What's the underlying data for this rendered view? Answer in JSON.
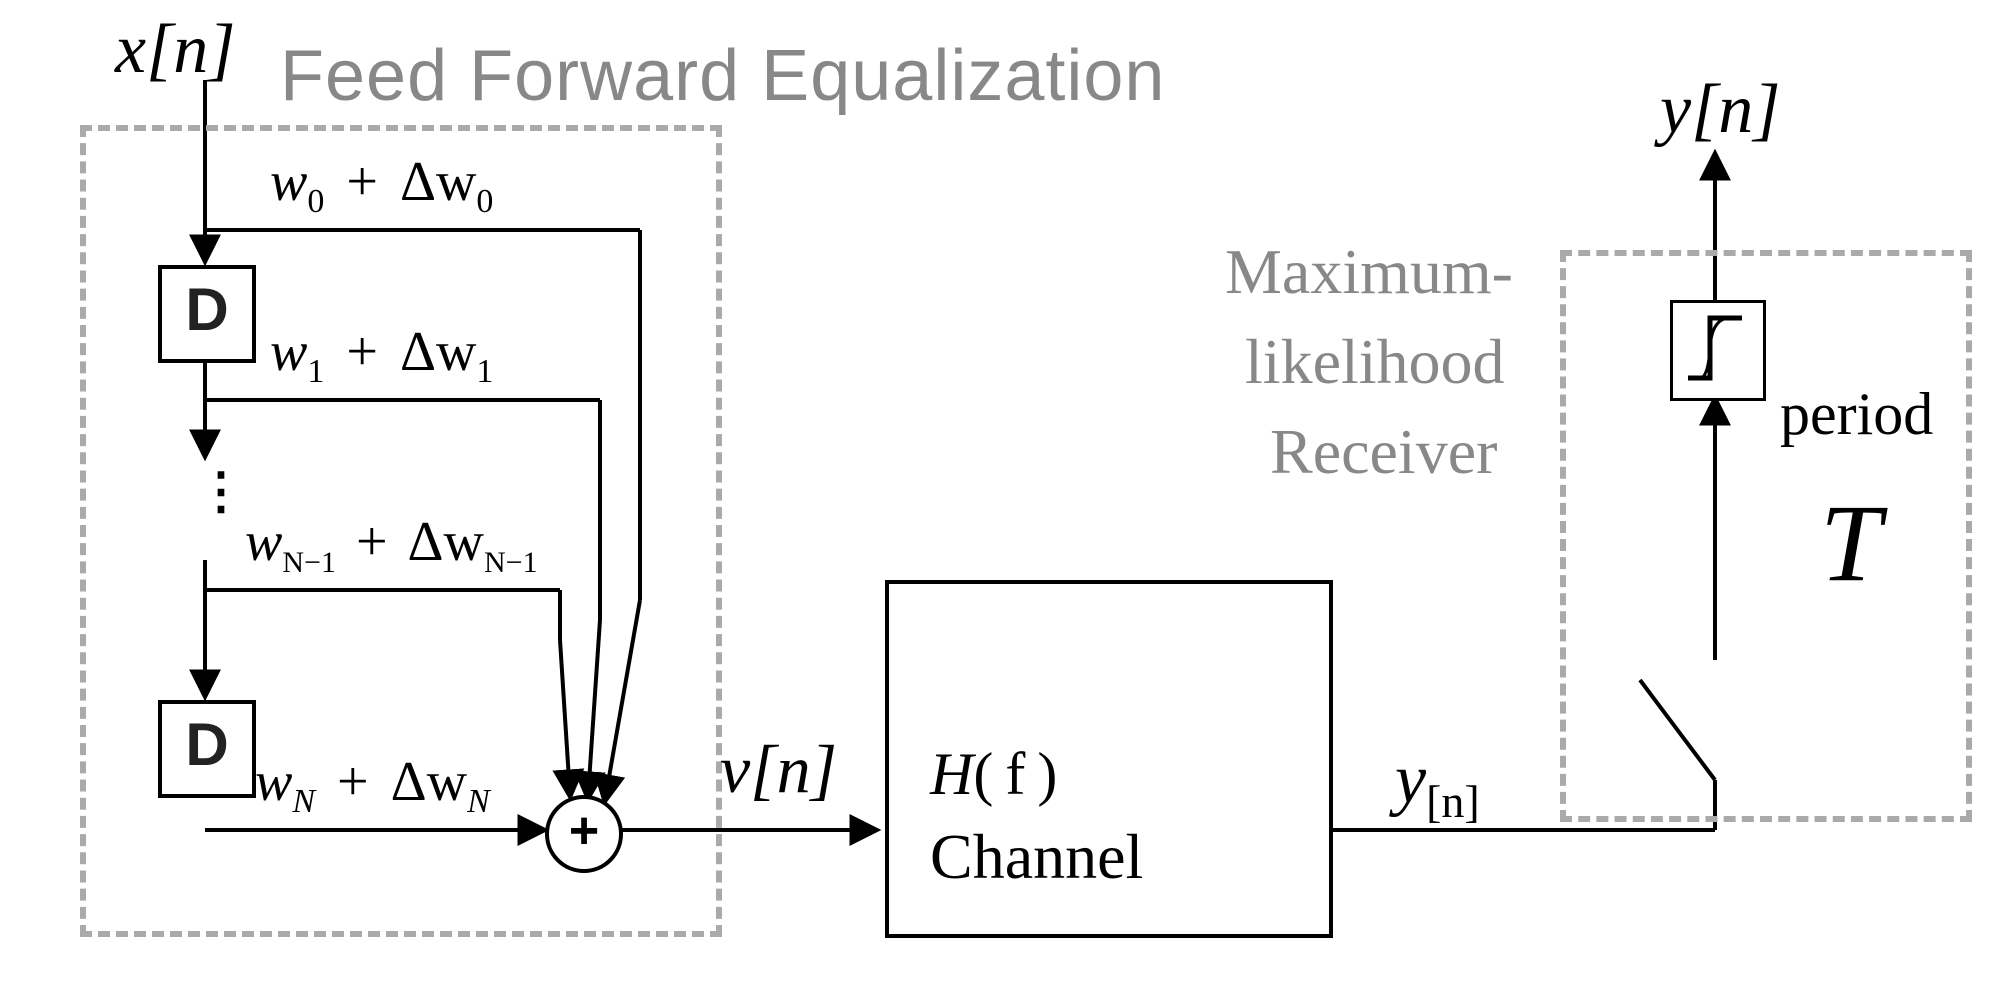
{
  "title": "Feed Forward Equalization",
  "receiver": {
    "line1": "Maximum-",
    "line2": "likelihood",
    "line3": "Receiver"
  },
  "signals": {
    "xin": "x[n]",
    "vn": "v[n]",
    "yn_lower": "y",
    "yn_sub_bracket": "[n]",
    "yout": "y[n]"
  },
  "taps": {
    "w0": "w",
    "dw0": "Δw",
    "s0": "0",
    "w1": "w",
    "dw1": "Δw",
    "s1": "1",
    "wNm1": "w",
    "dwNm1": "Δw",
    "sNm1": "N−1",
    "wN": "w",
    "dwN": "Δw",
    "sN": "N",
    "plus": "+"
  },
  "channel": {
    "H": "H",
    "f": "( f )",
    "label": "Channel"
  },
  "sampler": {
    "period_label": "period",
    "T": "T"
  },
  "blocks": {
    "D": "D",
    "sum": "+",
    "decision": "ʃ"
  }
}
